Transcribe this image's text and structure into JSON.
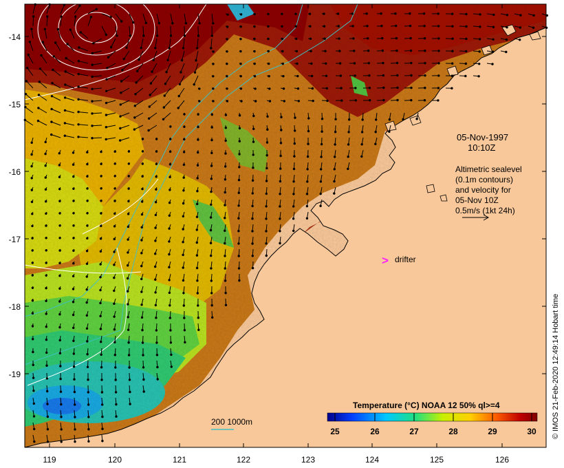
{
  "map": {
    "lon_ticks": [
      "119",
      "120",
      "121",
      "122",
      "123",
      "124",
      "125",
      "126"
    ],
    "lat_ticks": [
      "-14",
      "-15",
      "-16",
      "-17",
      "-18",
      "-19"
    ],
    "date": "05-Nov-1997",
    "time": "10:10Z",
    "legend_lines": [
      "Altimetric sealevel",
      "(0.1m contours)",
      "and velocity for",
      "05-Nov 10Z",
      "0.5m/s (1kt 24h)"
    ],
    "drifter_label": "drifter",
    "drifter_marker": ">",
    "isobath_label": "200  1000m",
    "colorbar": {
      "title": "Temperature (°C) NOAA 12 50% ql>=4",
      "ticks": [
        "25",
        "26",
        "27",
        "28",
        "29",
        "30"
      ],
      "min": 24.5,
      "max": 30.2
    },
    "credit": "© IMOS 21-Feb-2020 12:49:14 Hobart time",
    "colors": {
      "land": "#f8c89a",
      "warm": "#8b0000",
      "mid": "#e0a000",
      "cool": "#c8e820",
      "cold": "#20b0e0",
      "isobath": "#40c0c0",
      "drifter": "#ff20ff"
    }
  }
}
